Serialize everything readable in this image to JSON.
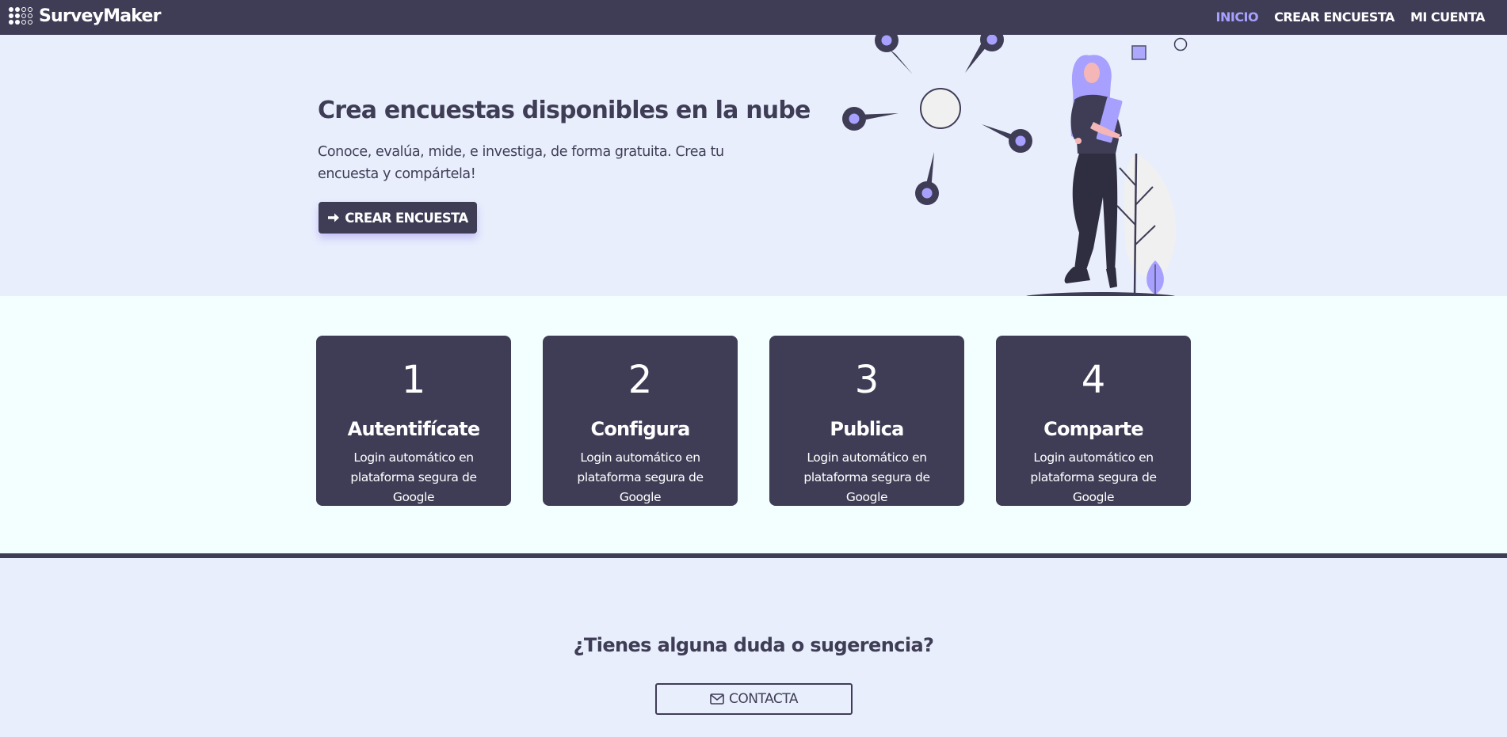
{
  "navbar": {
    "brand": "SurveyMaker",
    "links": [
      {
        "label": "INICIO",
        "active": true
      },
      {
        "label": "CREAR ENCUESTA",
        "active": false
      },
      {
        "label": "MI CUENTA",
        "active": false
      }
    ]
  },
  "hero": {
    "title": "Crea encuestas disponibles en la nube",
    "subtitle": "Conoce, evalúa, mide, e investiga, de forma gratuita. Crea tu encuesta y compártela!",
    "button_label": "CREAR ENCUESTA",
    "button_icon": "arrow-right-icon"
  },
  "steps": [
    {
      "number": "1",
      "title": "Autentifícate",
      "description": "Login automático en plataforma segura de Google"
    },
    {
      "number": "2",
      "title": "Configura",
      "description": "Login automático en plataforma segura de Google"
    },
    {
      "number": "3",
      "title": "Publica",
      "description": "Login automático en plataforma segura de Google"
    },
    {
      "number": "4",
      "title": "Comparte",
      "description": "Login automático en plataforma segura de Google"
    }
  ],
  "contact": {
    "question": "¿Tienes alguna duda o sugerencia?",
    "button_label": "CONTACTA",
    "button_icon": "envelope-icon"
  },
  "colors": {
    "primary": "#3f3d56",
    "accent": "#a8a0ff",
    "hero_bg": "#e8eefc",
    "steps_bg": "#f2fffe"
  }
}
